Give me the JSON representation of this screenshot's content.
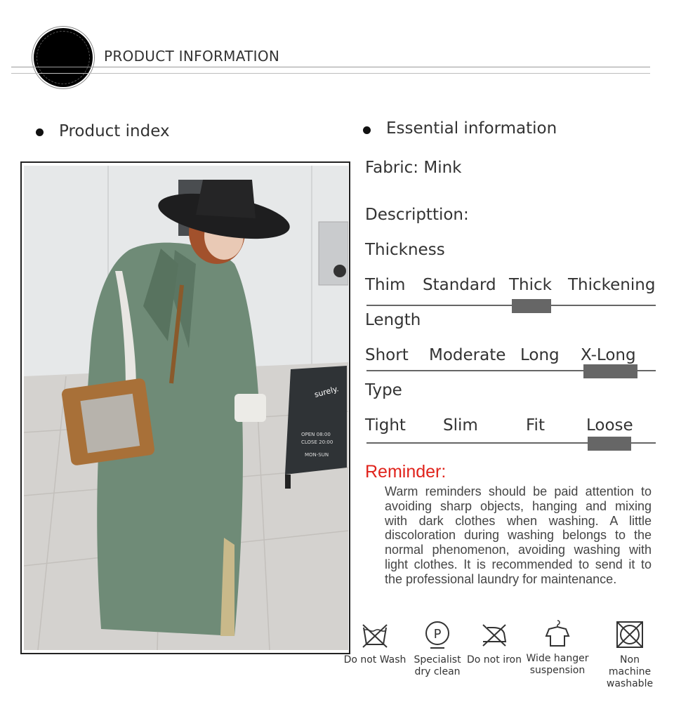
{
  "header": {
    "title": "PRODUCT INFORMATION"
  },
  "left": {
    "section_label": "Product index"
  },
  "photo": {
    "sign_brand": "surely.",
    "sign_line1": "OPEN 08:00",
    "sign_line2": "CLOSE 20:00",
    "sign_line3": "MON-SUN"
  },
  "right": {
    "section_label": "Essential information",
    "fabric": "Fabric: Mink",
    "description_label": "Descripttion:",
    "thickness": {
      "label": "Thickness",
      "options": [
        "Thim",
        "Standard",
        "Thick",
        "Thickening"
      ],
      "selected": "Thick"
    },
    "length": {
      "label": "Length",
      "options": [
        "Short",
        "Moderate",
        "Long",
        "X-Long"
      ],
      "selected": "X-Long"
    },
    "type": {
      "label": "Type",
      "options": [
        "Tight",
        "Slim",
        "Fit",
        "Loose"
      ],
      "selected": "Loose"
    }
  },
  "reminder": {
    "title": "Reminder:",
    "body": "Warm reminders should be paid attention to avoiding sharp objects, hanging and mixing with dark clothes when washing. A little discoloration during washing belongs to the normal phenomenon, avoiding washing with light clothes. It is recommended to send it to the professional laundry for maintenance."
  },
  "care": [
    {
      "icon": "do-not-wash-icon",
      "label": "Do not Wash"
    },
    {
      "icon": "specialist-dry-clean-icon",
      "label": "Specialist dry clean"
    },
    {
      "icon": "do-not-iron-icon",
      "label": "Do not iron"
    },
    {
      "icon": "wide-hanger-icon",
      "label": "Wide hanger suspension"
    },
    {
      "icon": "non-machine-washable-icon",
      "label": "Non machine washable"
    }
  ]
}
